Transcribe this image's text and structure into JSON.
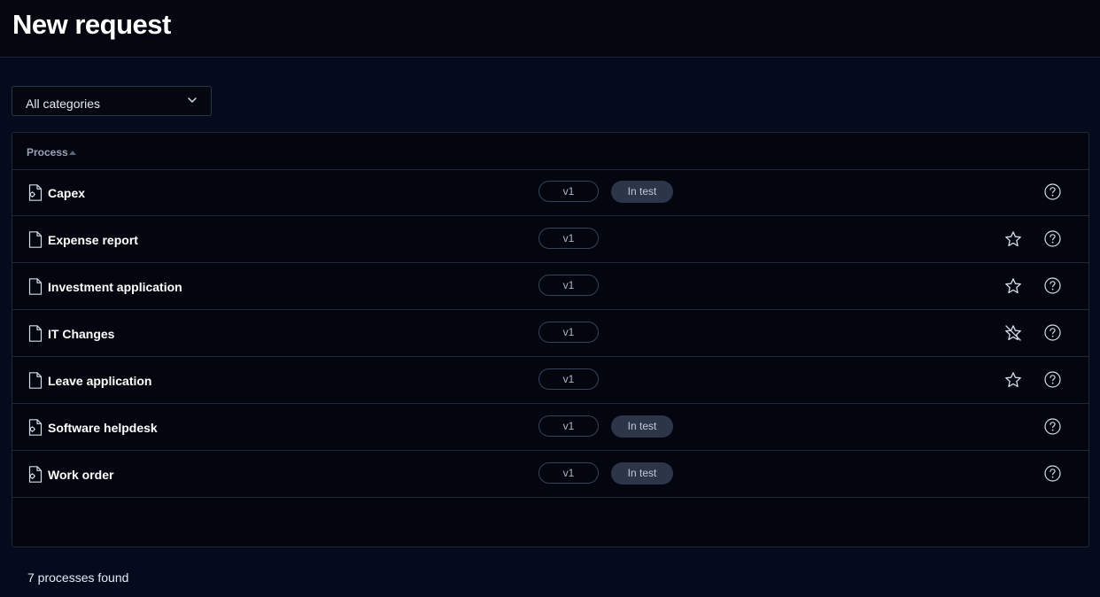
{
  "header": {
    "title": "New request"
  },
  "filter": {
    "selected": "All categories"
  },
  "table": {
    "column_header": "Process",
    "rows": [
      {
        "name": "Capex",
        "file_icon": "file-gear-icon",
        "version": "v1",
        "status": "In test",
        "favorite": "none"
      },
      {
        "name": "Expense report",
        "file_icon": "file-icon",
        "version": "v1",
        "status": "",
        "favorite": "star"
      },
      {
        "name": "Investment application",
        "file_icon": "file-icon",
        "version": "v1",
        "status": "",
        "favorite": "star"
      },
      {
        "name": "IT Changes",
        "file_icon": "file-icon",
        "version": "v1",
        "status": "",
        "favorite": "star-off"
      },
      {
        "name": "Leave application",
        "file_icon": "file-icon",
        "version": "v1",
        "status": "",
        "favorite": "star"
      },
      {
        "name": "Software helpdesk",
        "file_icon": "file-gear-icon",
        "version": "v1",
        "status": "In test",
        "favorite": "none"
      },
      {
        "name": "Work order",
        "file_icon": "file-gear-icon",
        "version": "v1",
        "status": "In test",
        "favorite": "none"
      }
    ]
  },
  "footer": {
    "count_text": "7 processes found"
  }
}
